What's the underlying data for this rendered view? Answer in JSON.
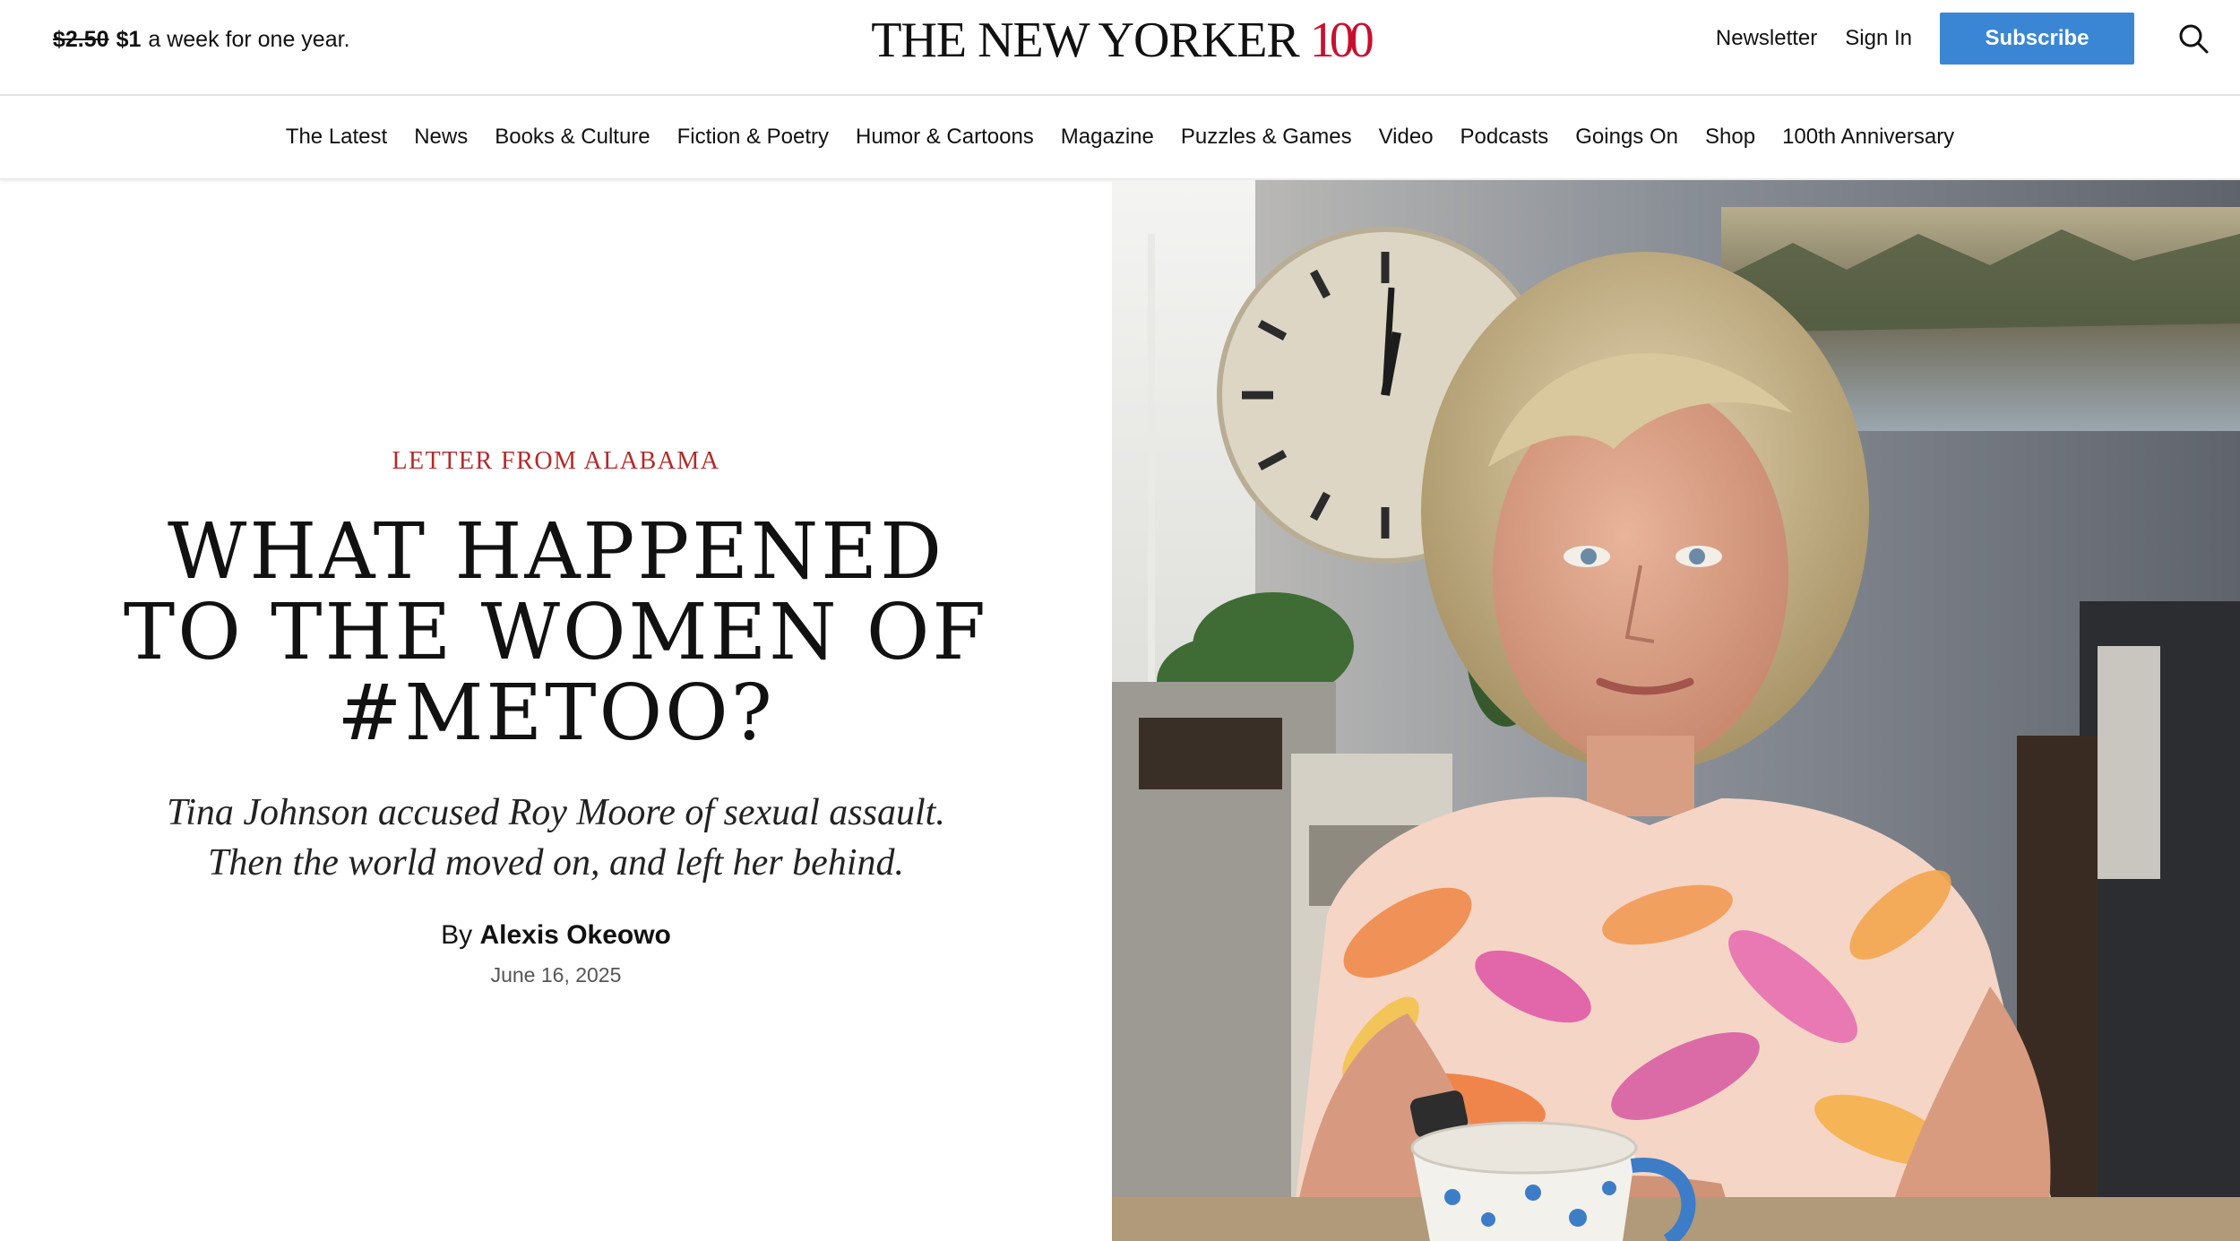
{
  "promo": {
    "old_price": "$2.50",
    "new_price": "$1",
    "rest": "a week for one year."
  },
  "logo": {
    "text": "THE NEW YORKER",
    "anniversary": "100"
  },
  "header": {
    "newsletter": "Newsletter",
    "sign_in": "Sign In",
    "subscribe": "Subscribe",
    "search_icon": "search-icon"
  },
  "nav": {
    "items": [
      "The Latest",
      "News",
      "Books & Culture",
      "Fiction & Poetry",
      "Humor & Cartoons",
      "Magazine",
      "Puzzles & Games",
      "Video",
      "Podcasts",
      "Goings On",
      "Shop",
      "100th Anniversary"
    ]
  },
  "article": {
    "rubric": "Letter from Alabama",
    "headline": "WHAT HAPPENED TO THE WOMEN OF #METOO?",
    "dek": "Tina Johnson accused Roy Moore of sexual assault. Then the world moved on, and left her behind.",
    "byline_prefix": "By",
    "author": "Alexis Okeowo",
    "date": "June 16, 2025"
  },
  "colors": {
    "accent_red": "#b22b2b",
    "subscribe_blue": "#3b86d4",
    "logo_red": "#c8102e"
  }
}
